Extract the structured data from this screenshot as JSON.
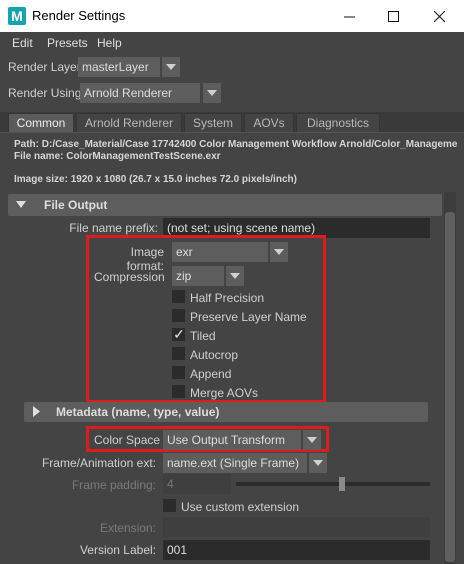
{
  "window": {
    "title": "Render Settings",
    "app_icon_letter": "M"
  },
  "menu": [
    "Edit",
    "Presets",
    "Help"
  ],
  "render_layer": {
    "label": "Render Layer",
    "value": "masterLayer"
  },
  "render_using": {
    "label": "Render Using",
    "value": "Arnold Renderer"
  },
  "tabs": [
    "Common",
    "Arnold Renderer",
    "System",
    "AOVs",
    "Diagnostics"
  ],
  "info": {
    "path": "Path: D:/Case_Material/Case 17742400 Color Management Workflow Arnold/Color_Manageme",
    "file_name": "File name:  ColorManagementTestScene.exr",
    "image_size": "Image size: 1920 x 1080 (26.7 x 15.0 inches 72.0 pixels/inch)"
  },
  "file_output": {
    "title": "File Output",
    "prefix_label": "File name prefix:",
    "prefix_value": "(not set; using scene name)",
    "image_format_label": "Image format:",
    "image_format_value": "exr",
    "compression_label": "Compression",
    "compression_value": "zip",
    "options": [
      {
        "label": "Half Precision",
        "checked": false
      },
      {
        "label": "Preserve Layer Name",
        "checked": false
      },
      {
        "label": "Tiled",
        "checked": true
      },
      {
        "label": "Autocrop",
        "checked": false
      },
      {
        "label": "Append",
        "checked": false
      },
      {
        "label": "Merge AOVs",
        "checked": false
      }
    ],
    "check_mark": "✓"
  },
  "metadata": {
    "title": "Metadata (name, type, value)"
  },
  "color_space": {
    "label": "Color Space",
    "value": "Use Output Transform"
  },
  "frame_ext": {
    "label": "Frame/Animation ext:",
    "value": "name.ext (Single Frame)"
  },
  "frame_padding": {
    "label": "Frame padding:",
    "value": "4",
    "level": 0.55
  },
  "custom_extension": {
    "label": "Use custom extension",
    "checked": false
  },
  "extension": {
    "label": "Extension:",
    "value": ""
  },
  "version_label": {
    "label": "Version Label:",
    "value": "001"
  },
  "colors": {
    "highlight": "#e01b1b",
    "panel": "#444444",
    "field": "#2b2b2b",
    "button": "#5d5d5d"
  }
}
